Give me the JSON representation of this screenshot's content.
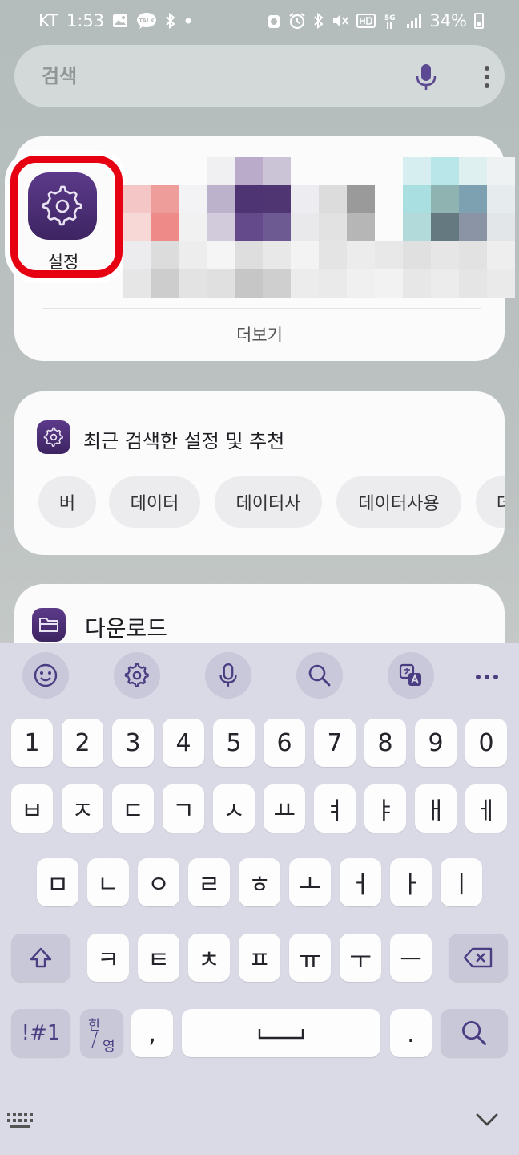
{
  "status_bar": {
    "carrier": "KT",
    "time": "1:53",
    "talk_badge": "TALK",
    "battery": "34%",
    "icons": [
      "gallery-icon",
      "talk-icon",
      "bluetooth-icon",
      "dot-icon",
      "alarm-icon",
      "bluetooth-icon",
      "mute-icon",
      "hd-icon",
      "5g-icon",
      "signal-icon",
      "battery-icon"
    ],
    "text_color": "#ffffff"
  },
  "search": {
    "placeholder": "검색",
    "icons": [
      "mic-icon",
      "more-vertical-icon"
    ]
  },
  "apps": {
    "items": [
      {
        "label": "설정",
        "icon": "settings-gear-icon"
      }
    ],
    "more_label": "더보기",
    "highlight_color": "#e60012"
  },
  "recent": {
    "title": "최근 검색한 설정 및 추천",
    "icon": "settings-gear-icon",
    "chips": [
      "버",
      "데이터",
      "데이터사",
      "데이터사용",
      "데"
    ]
  },
  "download": {
    "title": "다운로드",
    "icon": "folder-icon"
  },
  "keyboard": {
    "toolbar": [
      "emoji-icon",
      "settings-icon",
      "mic-icon",
      "search-icon",
      "translate-icon",
      "more-horizontal-icon"
    ],
    "row_numbers": [
      "1",
      "2",
      "3",
      "4",
      "5",
      "6",
      "7",
      "8",
      "9",
      "0"
    ],
    "row1": [
      "ㅂ",
      "ㅈ",
      "ㄷ",
      "ㄱ",
      "ㅅ",
      "ㅛ",
      "ㅕ",
      "ㅑ",
      "ㅐ",
      "ㅔ"
    ],
    "row2": [
      "ㅁ",
      "ㄴ",
      "ㅇ",
      "ㄹ",
      "ㅎ",
      "ㅗ",
      "ㅓ",
      "ㅏ",
      "ㅣ"
    ],
    "row3": [
      "ㅋ",
      "ㅌ",
      "ㅊ",
      "ㅍ",
      "ㅠ",
      "ㅜ",
      "ㅡ"
    ],
    "symbols_label": "!#1",
    "lang_top": "한",
    "lang_bottom": "영",
    "comma": ",",
    "period": ".",
    "icons": [
      "shift-icon",
      "backspace-icon",
      "space-icon",
      "search-icon",
      "keyboard-grid-icon",
      "chevron-down-icon"
    ],
    "accent_color": "#4a3d82"
  }
}
